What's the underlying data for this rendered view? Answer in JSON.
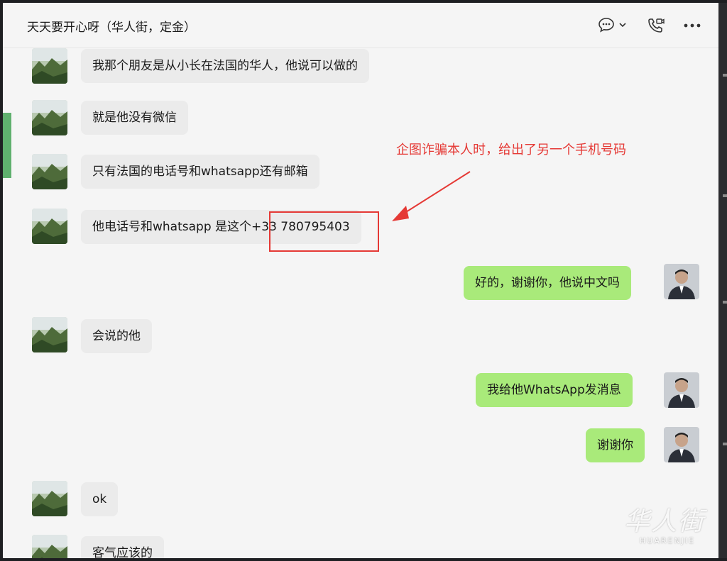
{
  "header": {
    "title": "天天要开心呀（华人街，定金）",
    "icons": [
      "chat-bubble-icon",
      "chevron-down-icon",
      "phone-video-icon",
      "more-icon"
    ]
  },
  "messages": [
    {
      "side": "in",
      "text": "我那个朋友是从小长在法国的华人，他说可以做的"
    },
    {
      "side": "in",
      "text": "就是他没有微信"
    },
    {
      "side": "in",
      "text": "只有法国的电话号和whatsapp还有邮箱"
    },
    {
      "side": "in",
      "text_prefix": "他电话号和whatsapp 是这个",
      "text_highlight": "+33 780795403"
    },
    {
      "side": "out",
      "text": "好的，谢谢你，他说中文吗"
    },
    {
      "side": "in",
      "text": "会说的他"
    },
    {
      "side": "out",
      "text": "我给他WhatsApp发消息"
    },
    {
      "side": "out",
      "text": "谢谢你"
    },
    {
      "side": "in",
      "text": "ok"
    },
    {
      "side": "in",
      "text": "客气应该的"
    }
  ],
  "annotation": {
    "text": "企图诈骗本人时，给出了另一个手机号码",
    "color": "#e53935"
  },
  "watermark": {
    "cn": "华人街",
    "en": "HUARENJIE"
  },
  "colors": {
    "incoming": "#ebebeb",
    "outgoing": "#a9ea7a",
    "accent": "#5fb06e",
    "annotation": "#e53935"
  }
}
